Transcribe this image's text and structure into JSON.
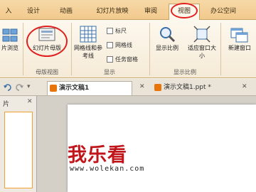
{
  "tabs": [
    {
      "label": "入"
    },
    {
      "label": "设计"
    },
    {
      "label": "动画"
    },
    {
      "label": "幻灯片放映"
    },
    {
      "label": "审阅"
    },
    {
      "label": "视图"
    },
    {
      "label": "办公空间"
    }
  ],
  "ribbon": {
    "slide_browse_label": "片浏览",
    "slide_master_label": "幻灯片母版",
    "grid_ref_label": "网格线和参考线",
    "ruler_label": "标尺",
    "gridline_label": "网格线",
    "taskpane_label": "任务窗格",
    "zoom_label": "显示比例",
    "fit_label": "适应窗口大小",
    "new_window_label": "新建窗口",
    "group_master": "母版视图",
    "group_show": "显示",
    "group_zoom": "显示比例"
  },
  "doc_tabs": [
    {
      "label": "演示文稿1"
    },
    {
      "label": "演示文稿1.ppt *"
    }
  ],
  "left_pane_label": "片",
  "watermark": {
    "text": "我乐看",
    "url": "www.wolekan.com"
  },
  "colors": {
    "accent": "#e02020",
    "ribbon_bg": "#fdf8ee",
    "tab_bg": "#f2c98c",
    "logo_red": "#c0151b"
  }
}
